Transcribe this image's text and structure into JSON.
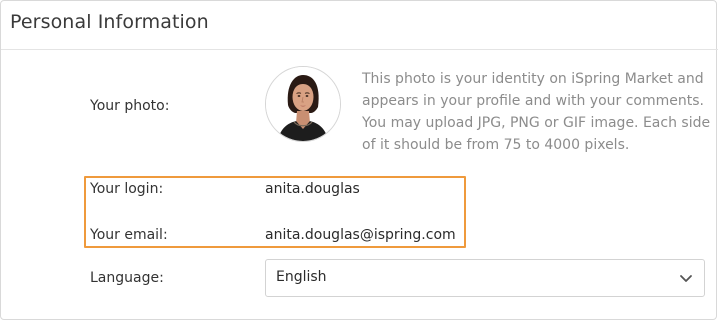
{
  "section": {
    "title": "Personal Information"
  },
  "photo": {
    "label": "Your photo:",
    "description": "This photo is your identity on iSpring Market and appears in your profile and with your comments. You may upload JPG, PNG or GIF image. Each side of it should be from 75 to 4000 pixels.",
    "avatar_icon": "user-portrait"
  },
  "login": {
    "label": "Your login:",
    "value": "anita.douglas"
  },
  "email": {
    "label": "Your email:",
    "value": "anita.douglas@ispring.com"
  },
  "language": {
    "label": "Language:",
    "selected": "English",
    "icon": "chevron-down-icon"
  },
  "colors": {
    "highlight": "#ef9a3c",
    "description_text": "#8c8c8c"
  }
}
